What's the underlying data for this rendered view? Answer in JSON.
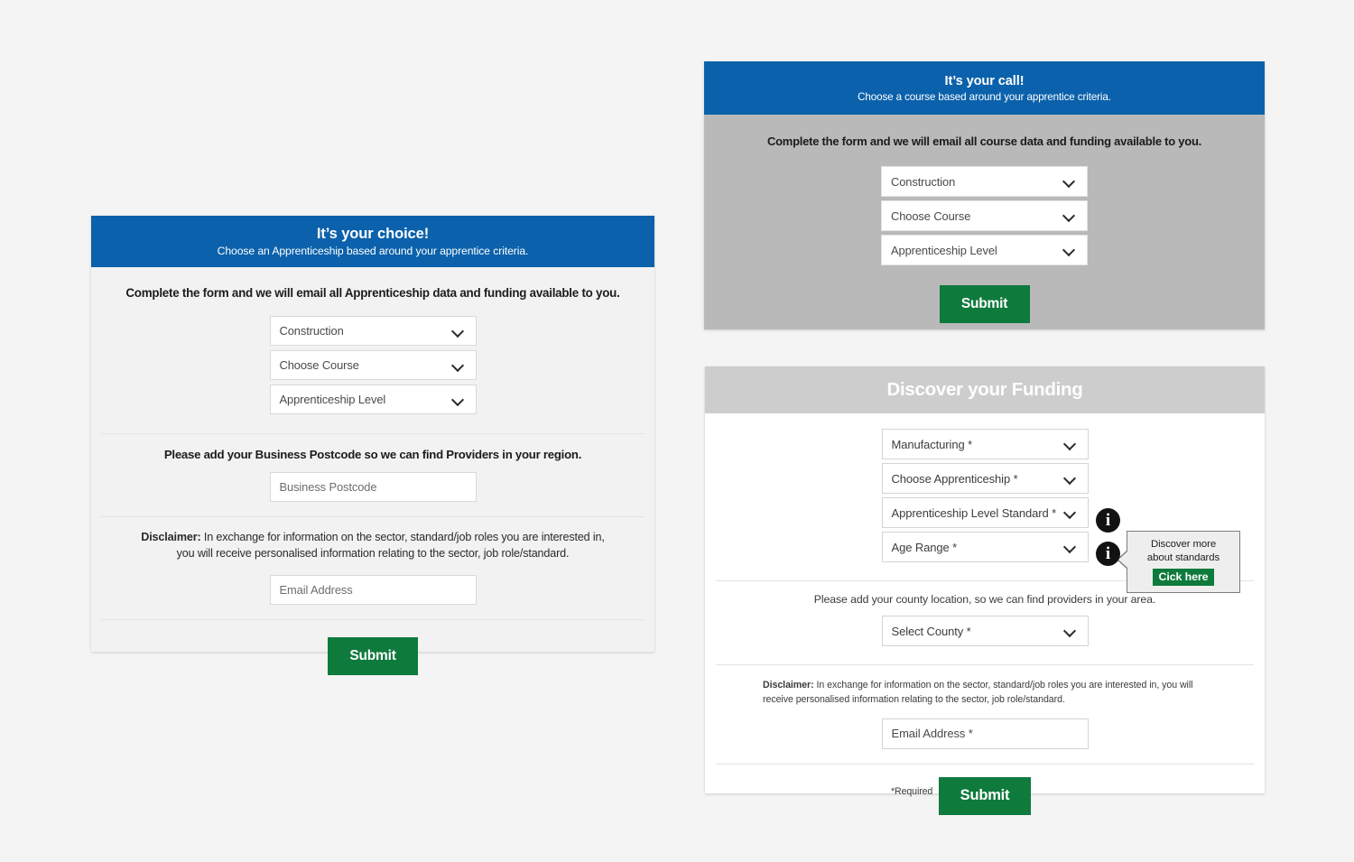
{
  "page": {
    "background": "#f4f4f4",
    "accent_blue": "#0b61ab",
    "accent_green": "#0e7a3c",
    "grey_header": "#cdcdcd",
    "grey_body": "#b9b9b9"
  },
  "choice_card": {
    "header_title": "It’s your choice!",
    "header_subtitle": "Choose an Apprenticeship based around your apprentice criteria.",
    "lead": "Complete the form and we will email all Apprenticeship data and funding available to you.",
    "selects": [
      {
        "value": "Construction",
        "icon": "chevron-down-icon"
      },
      {
        "value": "Choose Course",
        "icon": "chevron-down-icon"
      },
      {
        "value": "Apprenticeship Level",
        "icon": "chevron-down-icon"
      }
    ],
    "postcode_label": "Please add your Business Postcode so we can find Providers in your region.",
    "postcode_placeholder": "Business Postcode",
    "disclaimer_label": "Disclaimer:",
    "disclaimer_text": " In exchange for information on the sector, standard/job roles you are interested in, you will receive personalised information relating to the sector, job role/standard.",
    "email_placeholder": "Email Address",
    "submit_label": "Submit"
  },
  "call_card": {
    "header_title": "It’s your call!",
    "header_subtitle": "Choose a course based around your apprentice criteria.",
    "lead": "Complete the form and we will email all course data and funding available to you.",
    "selects": [
      {
        "value": "Construction",
        "icon": "chevron-down-icon"
      },
      {
        "value": "Choose Course",
        "icon": "chevron-down-icon"
      },
      {
        "value": "Apprenticeship Level",
        "icon": "chevron-down-icon"
      }
    ],
    "submit_label": "Submit"
  },
  "funding_card": {
    "header_title": "Discover your Funding",
    "selects": [
      {
        "value": "Manufacturing *",
        "icon": "chevron-down-icon"
      },
      {
        "value": "Choose Apprenticeship *",
        "icon": "chevron-down-icon"
      },
      {
        "value": "Apprenticeship Level Standard *",
        "icon": "chevron-down-icon"
      },
      {
        "value": "Age Range *",
        "icon": "chevron-down-icon"
      }
    ],
    "county_note": "Please add your county location, so we can find providers in your area.",
    "county_select": "Select County *",
    "disclaimer_label": "Disclaimer:",
    "disclaimer_text": " In exchange for information on the sector, standard/job roles you are interested in, you will receive personalised information relating to the sector, job role/standard.",
    "email_placeholder": "Email Address *",
    "required_note": "*Required",
    "submit_label": "Submit",
    "info_icon_1": "info-icon",
    "info_icon_2": "info-icon",
    "tooltip": {
      "line1": "Discover more",
      "line2": "about standards",
      "button_label": "Cick here"
    }
  }
}
